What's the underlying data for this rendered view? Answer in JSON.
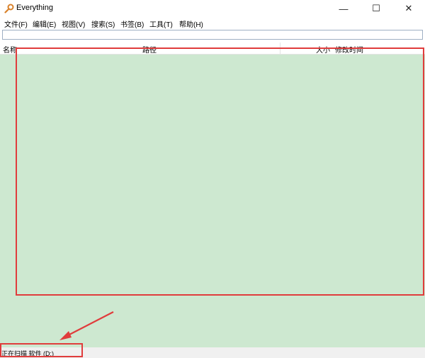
{
  "app": {
    "title": "Everything",
    "icon": "magnifier-key-icon",
    "accent_color": "#d9822b"
  },
  "window_controls": {
    "minimize": "—",
    "maximize": "☐",
    "close": "✕"
  },
  "menu": [
    {
      "label": "文件(F)"
    },
    {
      "label": "编辑(E)"
    },
    {
      "label": "视图(V)"
    },
    {
      "label": "搜索(S)"
    },
    {
      "label": "书签(B)"
    },
    {
      "label": "工具(T)"
    },
    {
      "label": "帮助(H)"
    }
  ],
  "search": {
    "value": "",
    "placeholder": ""
  },
  "columns": {
    "name": "名称",
    "path": "路径",
    "size": "大小",
    "modified": "修改时间"
  },
  "results": [],
  "status": {
    "text": "正在扫描 软件 (D:)"
  },
  "annotations": {
    "highlight_color": "#e03c3c",
    "list_area_color": "#cde8d0"
  }
}
